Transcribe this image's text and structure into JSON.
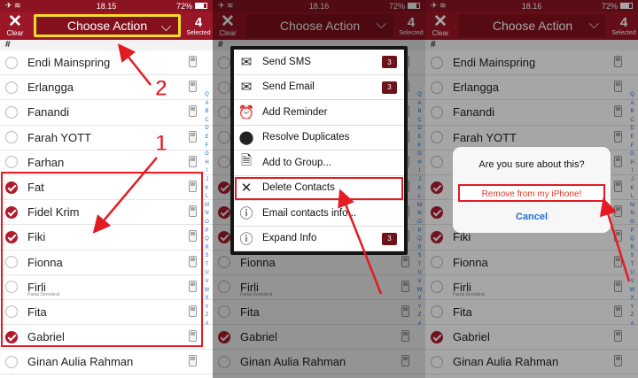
{
  "status": {
    "panel1": {
      "time": "18.15",
      "battery": "72%"
    },
    "panel2": {
      "time": "18.16",
      "battery": "72%"
    },
    "panel3": {
      "time": "18.16",
      "battery": "72%"
    }
  },
  "toolbar": {
    "clear_label": "Clear",
    "action_label": "Choose Action",
    "selected_count": "4",
    "selected_label": "Selected"
  },
  "section_header": "#",
  "contacts": [
    {
      "name": "Endi Mainspring",
      "checked": false,
      "sub": ""
    },
    {
      "name": "Erlangga",
      "checked": false,
      "sub": ""
    },
    {
      "name": "Fanandi",
      "checked": false,
      "sub": ""
    },
    {
      "name": "Farah YOTT",
      "checked": false,
      "sub": ""
    },
    {
      "name": "Farhan",
      "checked": false,
      "sub": ""
    },
    {
      "name": "Fat",
      "checked": true,
      "sub": ""
    },
    {
      "name": "Fidel Krim",
      "checked": true,
      "sub": ""
    },
    {
      "name": "Fiki",
      "checked": true,
      "sub": ""
    },
    {
      "name": "Fionna",
      "checked": false,
      "sub": ""
    },
    {
      "name": "Firli",
      "checked": false,
      "sub": "Partai Demokrat"
    },
    {
      "name": "Fita",
      "checked": false,
      "sub": ""
    },
    {
      "name": "Gabriel",
      "checked": true,
      "sub": ""
    },
    {
      "name": "Ginan Aulia Rahman",
      "checked": false,
      "sub": ""
    }
  ],
  "index_letters": [
    "Q",
    "A",
    "B",
    "C",
    "D",
    "E",
    "F",
    "G",
    "H",
    "I",
    "J",
    "K",
    "L",
    "M",
    "N",
    "O",
    "P",
    "Q",
    "R",
    "S",
    "T",
    "U",
    "V",
    "W",
    "X",
    "Y",
    "Z",
    "#"
  ],
  "menu": {
    "items": [
      {
        "label": "Send SMS",
        "icon": "sms-icon",
        "glyph": "✉",
        "badge": "3"
      },
      {
        "label": "Send Email",
        "icon": "email-icon",
        "glyph": "✉",
        "badge": "3"
      },
      {
        "label": "Add Reminder",
        "icon": "alarm-clock-icon",
        "glyph": "⏰",
        "badge": ""
      },
      {
        "label": "Resolve Duplicates",
        "icon": "duplicate-icon",
        "glyph": "⬤",
        "badge": ""
      },
      {
        "label": "Add to Group...",
        "icon": "document-icon",
        "glyph": "🗎",
        "badge": ""
      },
      {
        "label": "Delete Contacts",
        "icon": "close-icon",
        "glyph": "✕",
        "badge": ""
      },
      {
        "label": "Email contacts info...",
        "icon": "info-icon",
        "glyph": "ⓘ",
        "badge": ""
      },
      {
        "label": "Expand Info",
        "icon": "expand-info-icon",
        "glyph": "ⓘ",
        "badge": "3"
      }
    ]
  },
  "dialog": {
    "title": "Are you sure about this?",
    "confirm": "Remove from my iPhone!",
    "cancel": "Cancel"
  },
  "annotations": {
    "step1": "1",
    "step2": "2"
  },
  "colors": {
    "brand": "#9b1626",
    "highlight": "#e31b23",
    "yellow": "#f3dc2a"
  }
}
